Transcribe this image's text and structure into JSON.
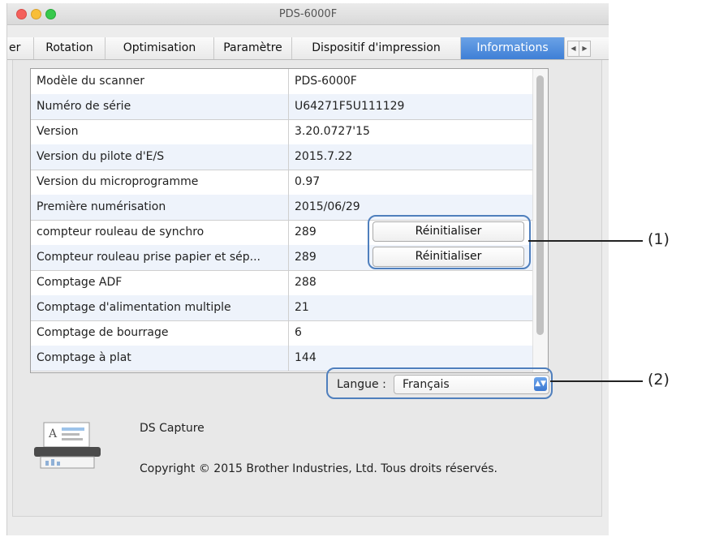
{
  "window": {
    "title": "PDS-6000F"
  },
  "tabs": [
    {
      "label": "er"
    },
    {
      "label": "Rotation"
    },
    {
      "label": "Optimisation"
    },
    {
      "label": "Paramètre"
    },
    {
      "label": "Dispositif d'impression"
    },
    {
      "label": "Informations",
      "active": true
    }
  ],
  "tab_nav": {
    "prev": "◀",
    "next": "▶"
  },
  "info_table": {
    "rows": [
      {
        "label": "Modèle du scanner",
        "value": "PDS-6000F"
      },
      {
        "label": "Numéro de série",
        "value": "U64271F5U111129"
      },
      {
        "label": "Version",
        "value": "3.20.0727'15"
      },
      {
        "label": "Version du pilote d'E/S",
        "value": "2015.7.22"
      },
      {
        "label": "Version du microprogramme",
        "value": "0.97"
      },
      {
        "label": "Première numérisation",
        "value": "2015/06/29"
      },
      {
        "label": "compteur rouleau de synchro",
        "value": "289"
      },
      {
        "label": "Compteur rouleau prise papier et sép...",
        "value": "289"
      },
      {
        "label": "Comptage ADF",
        "value": "288"
      },
      {
        "label": "Comptage d'alimentation multiple",
        "value": "21"
      },
      {
        "label": "Comptage de bourrage",
        "value": "6"
      },
      {
        "label": "Comptage à plat",
        "value": "144"
      }
    ]
  },
  "reset_buttons": [
    "Réinitialiser",
    "Réinitialiser"
  ],
  "language": {
    "label": "Langue :",
    "value": "Français"
  },
  "about": {
    "app_name": "DS Capture",
    "copyright": "Copyright © 2015 Brother Industries, Ltd. Tous droits réservés."
  },
  "callouts": [
    "(1)",
    "(2)"
  ],
  "colors": {
    "accent": "#3f7fd6",
    "callout_border": "#4f7fbd",
    "row_alt": "#eef3fb"
  }
}
